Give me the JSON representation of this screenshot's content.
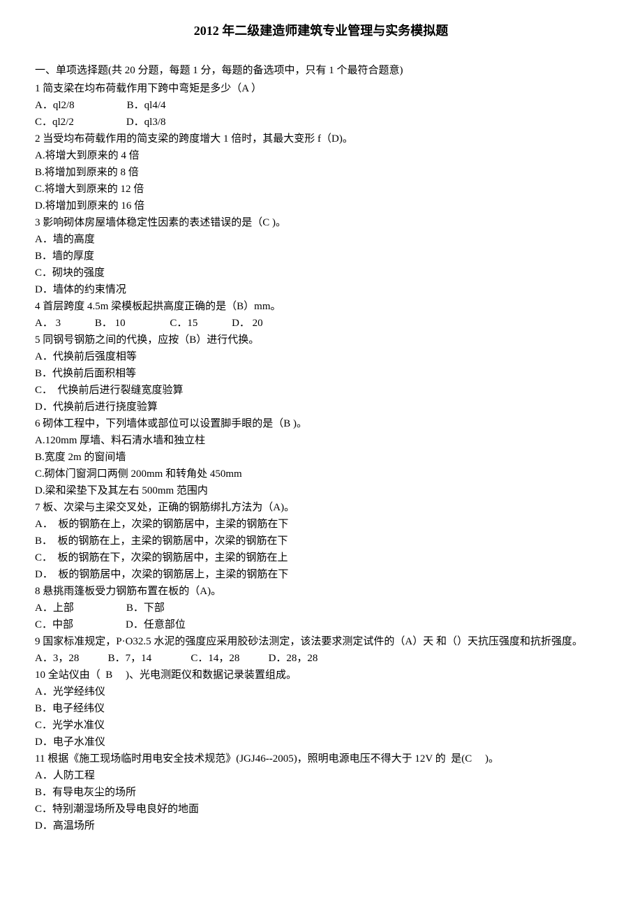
{
  "title": "2012 年二级建造师建筑专业管理与实务模拟题",
  "section1_header": "一、单项选择题(共 20 分题，每题 1 分，每题的备选项中，只有 1 个最符合题意)",
  "q1": {
    "stem": "1 简支梁在均布荷载作用下跨中弯矩是多少（A ）",
    "row1": "A．ql2/8                    B．ql4/4",
    "row2": "C．ql2/2                    D．ql3/8"
  },
  "q2": {
    "stem": "2 当受均布荷载作用的简支梁的跨度增大 1 倍时，其最大变形 f（D)。",
    "a": "A.将增大到原来的 4 倍",
    "b": "B.将增加到原来的 8 倍",
    "c": "C.将增大到原来的 12 倍",
    "d": "D.将增加到原来的 16 倍"
  },
  "q3": {
    "stem": "3 影响砌体房屋墙体稳定性因素的表述错误的是（C )。",
    "a": "A．墙的高度",
    "b": "B．墙的厚度",
    "c": "C．砌块的强度",
    "d": "D．墙体的约束情况"
  },
  "q4": {
    "stem": "4 首层跨度 4.5m 梁模板起拱高度正确的是（B）mm。",
    "opts": "A． 3             B． 10                 C．15             D． 20"
  },
  "q5": {
    "stem": "5 同钢号钢筋之间的代换，应按（B）进行代换。",
    "a": "A．代换前后强度相等",
    "b": "B．代换前后面积相等",
    "c": "C．  代换前后进行裂缝宽度验算",
    "d": "D．代换前后进行挠度验算"
  },
  "q6": {
    "stem": "6 砌体工程中，下列墙体或部位可以设置脚手眼的是（B )。",
    "a": "A.120mm 厚墙、料石清水墙和独立柱",
    "b": "B.宽度 2m 的窗间墙",
    "c": "C.砌体门窗洞口两侧 200mm 和转角处 450mm",
    "d": "D.梁和梁垫下及其左右 500mm 范围内"
  },
  "q7": {
    "stem": "7 板、次梁与主梁交叉处，正确的钢筋绑扎方法为（A)。",
    "a": "A．  板的钢筋在上，次梁的钢筋居中，主梁的钢筋在下",
    "b": "B．  板的钢筋在上，主梁的钢筋居中，次梁的钢筋在下",
    "c": "C．  板的钢筋在下，次梁的钢筋居中，主梁的钢筋在上",
    "d": "D．  板的钢筋居中，次梁的钢筋居上，主梁的钢筋在下"
  },
  "q8": {
    "stem": "8 悬挑雨篷板受力钢筋布置在板的（A)。",
    "row1": "A．上部                    B．下部",
    "row2": "C．中部                    D．任意部位"
  },
  "q9": {
    "stem": "9 国家标准规定，P·O32.5 水泥的强度应采用胶砂法测定，该法要求测定试件的（A）天 和（）天抗压强度和抗折强度。",
    "opts": "A．3，28           B．7，14               C．14，28           D．28，28"
  },
  "q10": {
    "stem": "10 全站仪由（  B     )、光电测距仪和数据记录装置组成。",
    "a": "A．光学经纬仪",
    "b": "B．电子经纬仪",
    "c": "C．光学水准仪",
    "d": "D．电子水准仪"
  },
  "q11": {
    "stem": "11 根据《施工现场临时用电安全技术规范》(JGJ46--2005)，照明电源电压不得大于 12V 的  是(C     )。",
    "a": "A．人防工程",
    "b": "B．有导电灰尘的场所",
    "c": "C．特别潮湿场所及导电良好的地面",
    "d": "D．高温场所"
  }
}
